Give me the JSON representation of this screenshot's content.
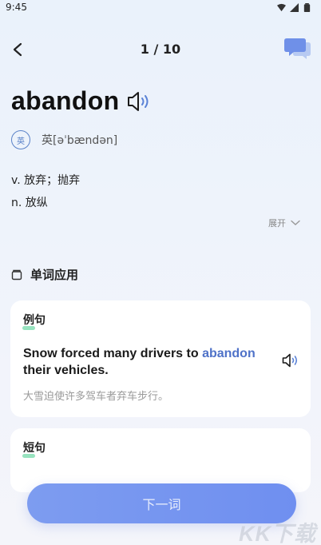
{
  "status_bar": {
    "time": "9:45"
  },
  "nav": {
    "page_counter": "1 / 10"
  },
  "word": {
    "headword": "abandon",
    "phonetic_tag": "英",
    "phonetic": "英[əˈbændən]"
  },
  "definitions": [
    "v. 放弃；抛弃",
    "n. 放纵"
  ],
  "expand": {
    "label": "展开"
  },
  "section": {
    "title": "单词应用"
  },
  "examples_card": {
    "label": "例句",
    "sentence_before": "Snow forced many drivers to ",
    "sentence_highlight": "abandon",
    "sentence_after": " their vehicles.",
    "translation": "大雪迫使许多驾车者弃车步行。"
  },
  "phrases_card": {
    "label": "短句"
  },
  "next_button": {
    "label": "下一词"
  },
  "watermark": {
    "text": "KK下载"
  },
  "colors": {
    "accent": "#4f72c8",
    "button": "#7390f0",
    "mark": "#8ce0b8"
  }
}
